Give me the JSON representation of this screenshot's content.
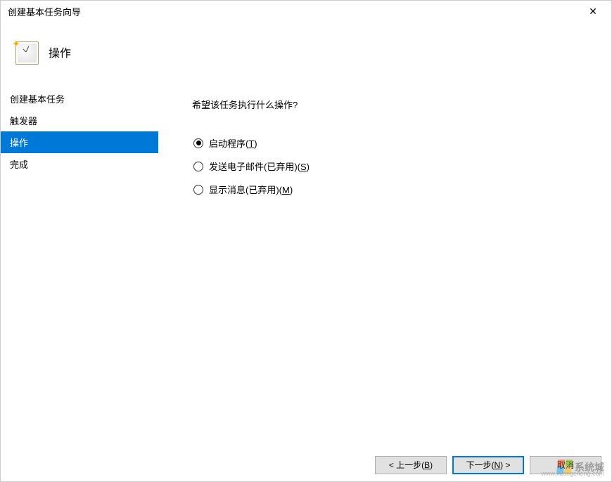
{
  "window": {
    "title": "创建基本任务向导"
  },
  "header": {
    "title": "操作"
  },
  "sidebar": {
    "items": [
      {
        "label": "创建基本任务",
        "selected": false
      },
      {
        "label": "触发器",
        "selected": false
      },
      {
        "label": "操作",
        "selected": true
      },
      {
        "label": "完成",
        "selected": false
      }
    ]
  },
  "content": {
    "question": "希望该任务执行什么操作?",
    "options": [
      {
        "label_prefix": "启动程序(",
        "key": "T",
        "label_suffix": ")",
        "checked": true
      },
      {
        "label_prefix": "发送电子邮件(已弃用)(",
        "key": "S",
        "label_suffix": ")",
        "checked": false
      },
      {
        "label_prefix": "显示消息(已弃用)(",
        "key": "M",
        "label_suffix": ")",
        "checked": false
      }
    ]
  },
  "footer": {
    "back_prefix": "< 上一步(",
    "back_key": "B",
    "back_suffix": ")",
    "next_prefix": "下一步(",
    "next_key": "N",
    "next_suffix": ") >",
    "cancel": "取消"
  },
  "watermark": {
    "brand": "系统城",
    "url": "www.xitongcheng.com"
  }
}
